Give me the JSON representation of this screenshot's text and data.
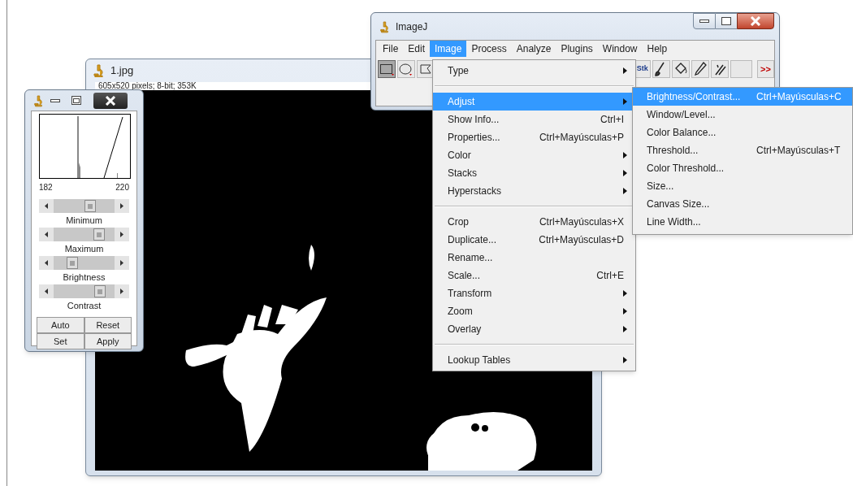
{
  "image_window": {
    "title": "1.jpg",
    "info": "605x520 pixels; 8-bit; 353K"
  },
  "bc_window": {
    "range_min": "182",
    "range_max": "220",
    "sliders": [
      {
        "label": "Minimum",
        "level": 0.62
      },
      {
        "label": "Maximum",
        "level": 0.8
      },
      {
        "label": "Brightness",
        "level": 0.26
      },
      {
        "label": "Contrast",
        "level": 0.82
      }
    ],
    "buttons": [
      "Auto",
      "Reset",
      "Set",
      "Apply"
    ]
  },
  "imagej_window": {
    "title": "ImageJ",
    "menus": [
      {
        "label": "File",
        "selected": false
      },
      {
        "label": "Edit",
        "selected": false
      },
      {
        "label": "Image",
        "selected": true
      },
      {
        "label": "Process",
        "selected": false
      },
      {
        "label": "Analyze",
        "selected": false
      },
      {
        "label": "Plugins",
        "selected": false
      },
      {
        "label": "Window",
        "selected": false
      },
      {
        "label": "Help",
        "selected": false
      }
    ],
    "tools": [
      {
        "kind": "rectangle",
        "selected": true
      },
      {
        "kind": "oval",
        "selected": false
      },
      {
        "kind": "polygon",
        "selected": false
      },
      {
        "kind": "stack",
        "label": "Stk",
        "selected": false
      },
      {
        "kind": "brush",
        "selected": false
      },
      {
        "kind": "bucket",
        "selected": false
      },
      {
        "kind": "pencil",
        "selected": false
      },
      {
        "kind": "wand",
        "selected": false
      },
      {
        "kind": "blank",
        "selected": false
      },
      {
        "kind": "more",
        "label": ">>",
        "selected": false
      }
    ]
  },
  "image_menu": {
    "items": [
      {
        "kind": "item",
        "label": "Type",
        "submenu": true,
        "selected": false
      },
      {
        "kind": "separator"
      },
      {
        "kind": "item",
        "label": "Adjust",
        "submenu": true,
        "selected": true
      },
      {
        "kind": "item",
        "label": "Show Info...",
        "shortcut": "Ctrl+I",
        "selected": false
      },
      {
        "kind": "item",
        "label": "Properties...",
        "shortcut": "Ctrl+Mayúsculas+P",
        "selected": false
      },
      {
        "kind": "item",
        "label": "Color",
        "submenu": true,
        "selected": false
      },
      {
        "kind": "item",
        "label": "Stacks",
        "submenu": true,
        "selected": false
      },
      {
        "kind": "item",
        "label": "Hyperstacks",
        "submenu": true,
        "selected": false
      },
      {
        "kind": "separator"
      },
      {
        "kind": "item",
        "label": "Crop",
        "shortcut": "Ctrl+Mayúsculas+X",
        "selected": false
      },
      {
        "kind": "item",
        "label": "Duplicate...",
        "shortcut": "Ctrl+Mayúsculas+D",
        "selected": false
      },
      {
        "kind": "item",
        "label": "Rename...",
        "selected": false
      },
      {
        "kind": "item",
        "label": "Scale...",
        "shortcut": "Ctrl+E",
        "selected": false
      },
      {
        "kind": "item",
        "label": "Transform",
        "submenu": true,
        "selected": false
      },
      {
        "kind": "item",
        "label": "Zoom",
        "submenu": true,
        "selected": false
      },
      {
        "kind": "item",
        "label": "Overlay",
        "submenu": true,
        "selected": false
      },
      {
        "kind": "separator"
      },
      {
        "kind": "item",
        "label": "Lookup Tables",
        "submenu": true,
        "selected": false
      }
    ]
  },
  "adjust_submenu": {
    "items": [
      {
        "label": "Brightness/Contrast...",
        "shortcut": "Ctrl+Mayúsculas+C",
        "selected": true
      },
      {
        "label": "Window/Level...",
        "selected": false
      },
      {
        "label": "Color Balance...",
        "selected": false
      },
      {
        "label": "Threshold...",
        "shortcut": "Ctrl+Mayúsculas+T",
        "selected": false
      },
      {
        "label": "Color Threshold...",
        "selected": false
      },
      {
        "label": "Size...",
        "selected": false
      },
      {
        "label": "Canvas Size...",
        "selected": false
      },
      {
        "label": "Line Width...",
        "selected": false
      }
    ]
  }
}
